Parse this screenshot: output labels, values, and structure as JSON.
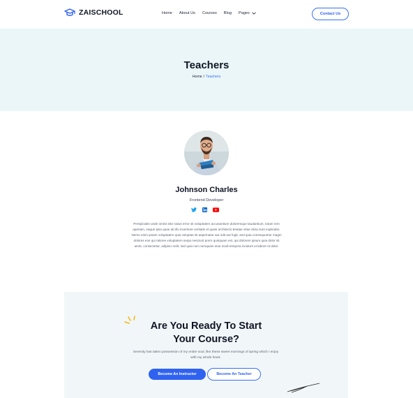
{
  "header": {
    "brand": "ZAISCHOOL",
    "nav": [
      "Home",
      "About Us",
      "Courses",
      "Blog",
      "Pages"
    ],
    "contact_label": "Contact Us"
  },
  "banner": {
    "title": "Teachers",
    "breadcrumb": {
      "home": "Home",
      "separator": "/",
      "current": "Teachers"
    }
  },
  "teacher": {
    "name": "Johnson Charles",
    "role": "Frontend Developer",
    "socials": [
      "twitter-icon",
      "linkedin-icon",
      "youtube-icon"
    ],
    "bio": "Perspiciatis unde omnis iste natus error sit voluptatem accusantium doloremque laudantium, totam rem aperiam, eaque ipsa quae ab illo inventore veritatis et quasi architecto beatae vitae dicta sunt explicabo. Nemo enim ipsam voluptatem quia voluptas sit aspernatur aut odit aut fugit, sed quia consequuntur magni dolores eos qui ratione voluptatem sequi nesciunt porro quisquam est, qui dolorem ipsum quia dolor sit amet, consectetur, adipisci velit, sed quia non numquam eius modi tempora incidunt ut labore et dolor."
  },
  "cta": {
    "title_line1": "Are You Ready To Start",
    "title_line2": "Your Course?",
    "text": "Serenity has taken possession of my entire soul, like these sweet mornings of spring which I enjoy with my whole heart.",
    "primary_button": "Become An Instructor",
    "secondary_button": "Become An Teacher"
  },
  "colors": {
    "accent": "#2f62f0",
    "banner_bg": "#eaf6f8",
    "cta_bg": "#f1f6f8",
    "twitter": "#1da1f2",
    "linkedin": "#0a66c2",
    "youtube": "#ff0000",
    "deco_yellow": "#f5b90a"
  }
}
